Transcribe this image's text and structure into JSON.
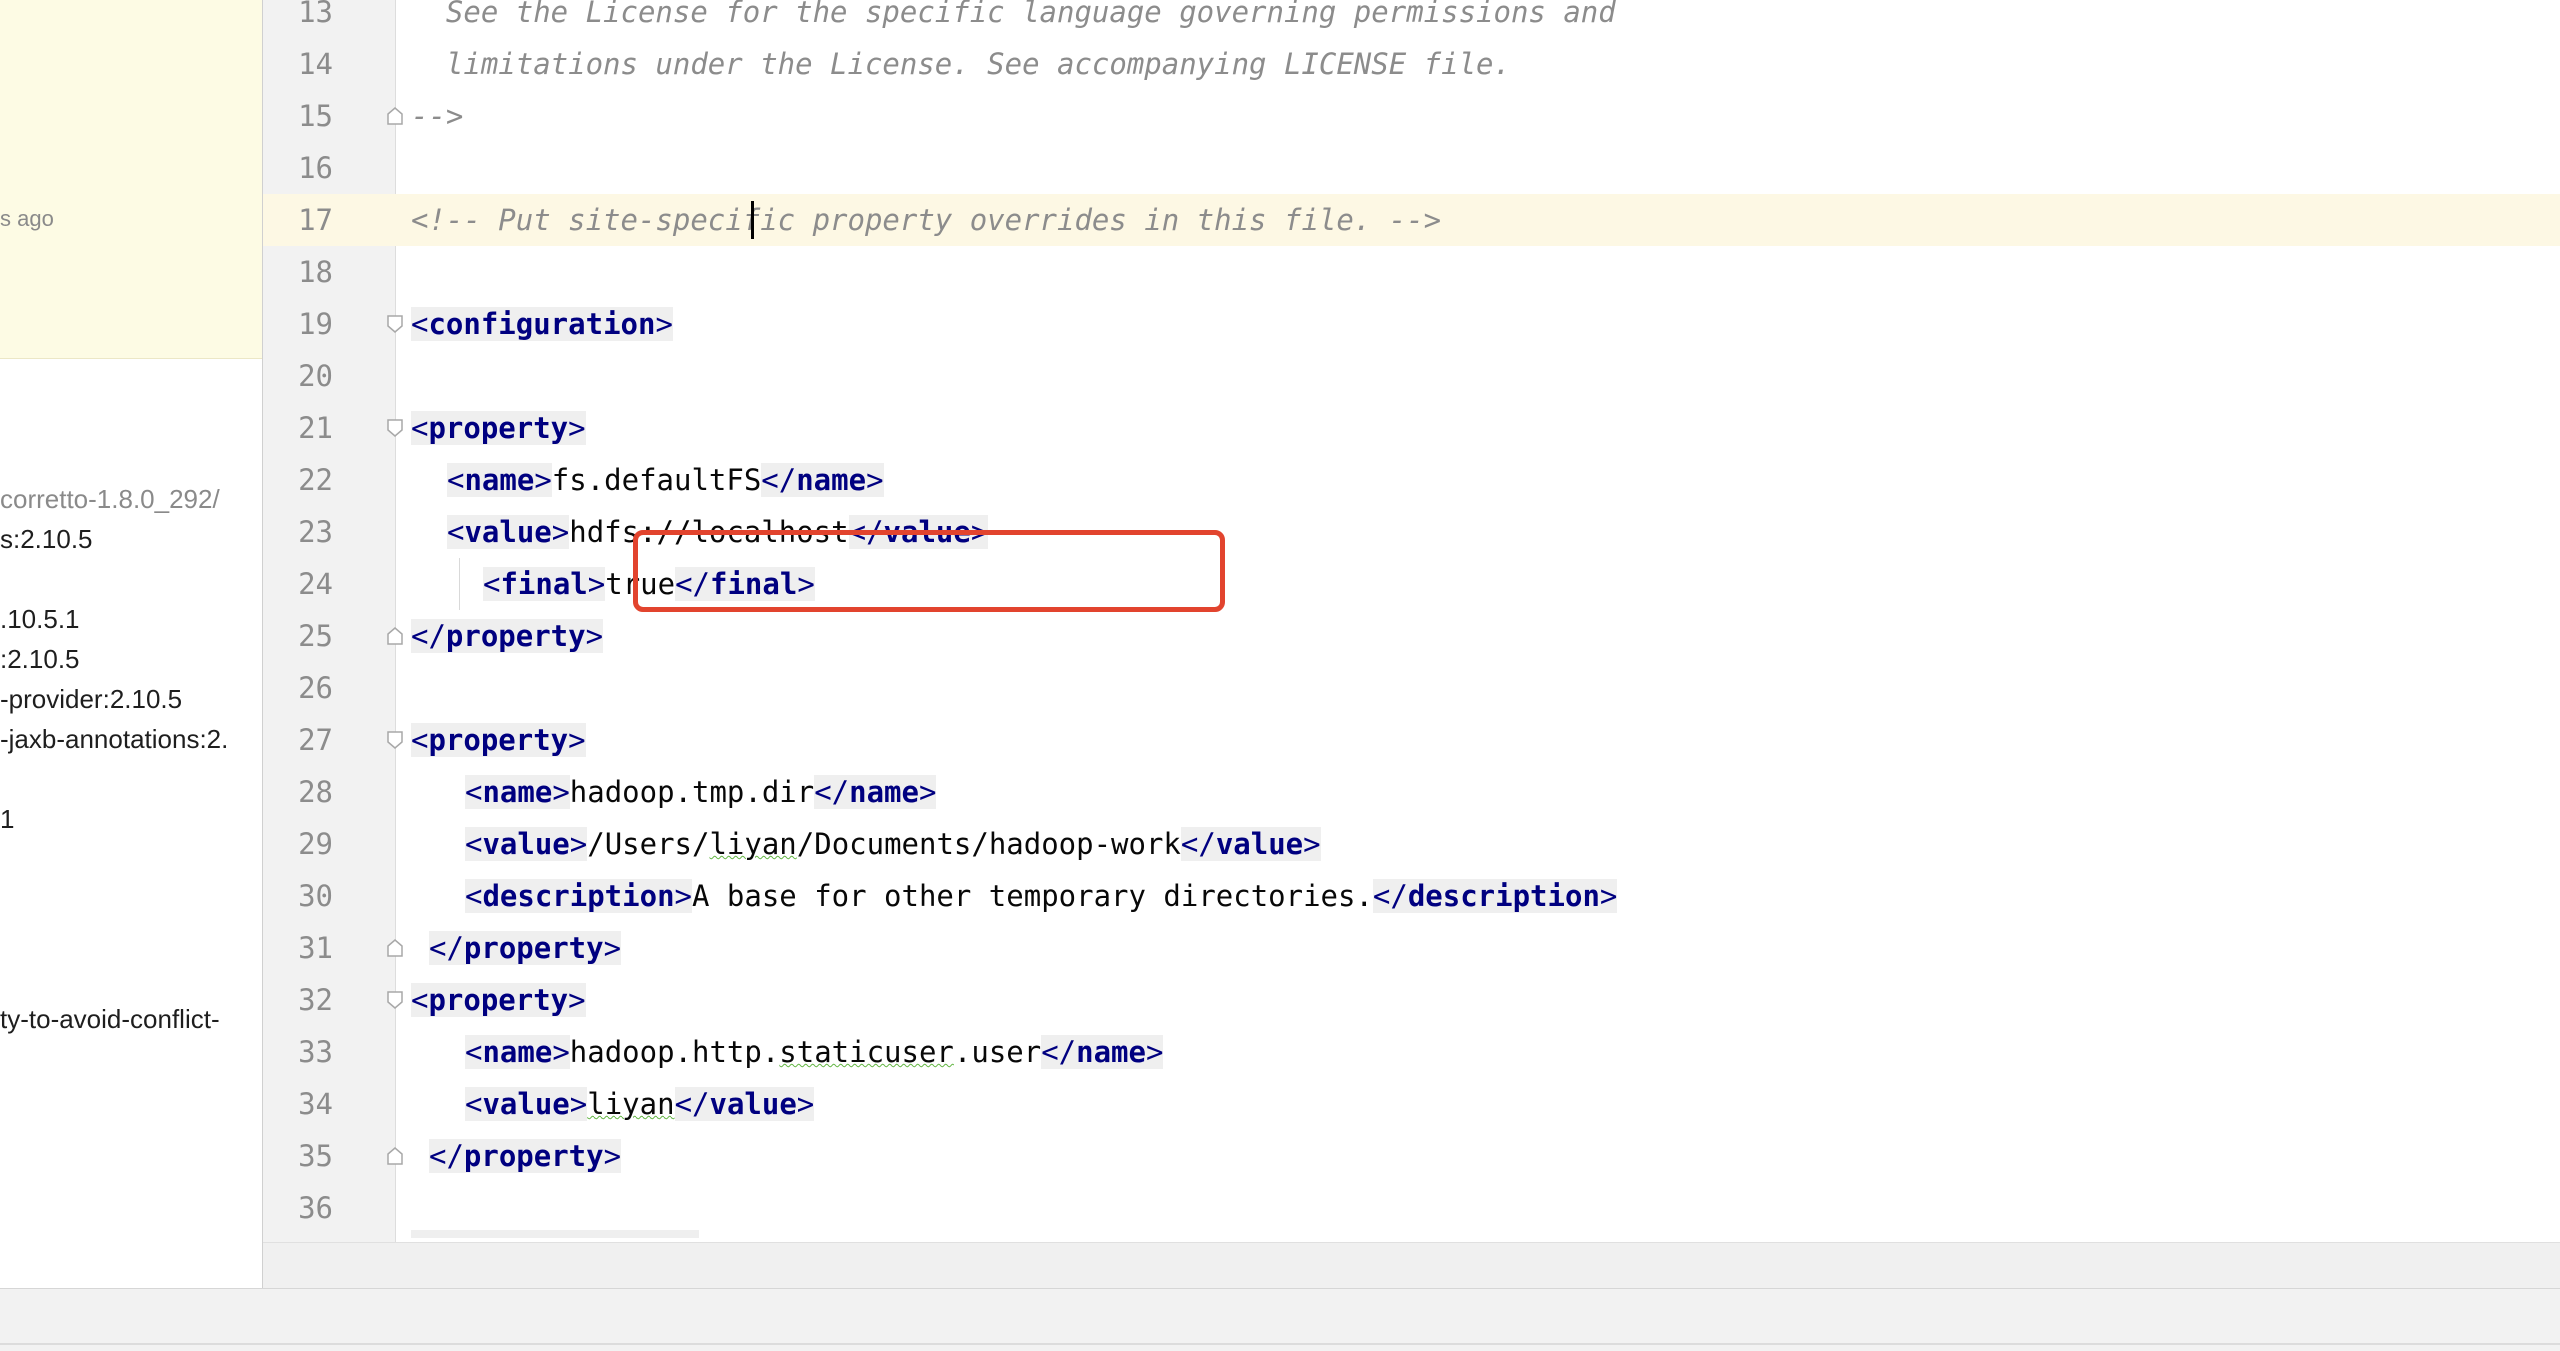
{
  "left_panel": {
    "vcs_time": "s ago",
    "libraries": [
      {
        "text": " corretto-1.8.0_292/",
        "muted": true
      },
      {
        "text": "s:2.10.5",
        "muted": false
      },
      {
        "text": "",
        "muted": false
      },
      {
        "text": ".10.5.1",
        "muted": false
      },
      {
        "text": ":2.10.5",
        "muted": false
      },
      {
        "text": "-provider:2.10.5",
        "muted": false
      },
      {
        "text": "-jaxb-annotations:2.",
        "muted": false
      },
      {
        "text": "",
        "muted": false
      },
      {
        "text": "1",
        "muted": false
      },
      {
        "text": "ty-to-avoid-conflict-",
        "muted": false
      }
    ]
  },
  "editor": {
    "lines": [
      {
        "n": "13",
        "text": "  See the License for the specific language governing permissions and"
      },
      {
        "n": "14",
        "text": "  limitations under the License. See accompanying LICENSE file."
      },
      {
        "n": "15",
        "text": "-->"
      },
      {
        "n": "16",
        "text": ""
      },
      {
        "n": "17",
        "text": "<!-- Put site-specific property overrides in this file. -->"
      },
      {
        "n": "18",
        "text": ""
      },
      {
        "n": "19",
        "tag": "configuration"
      },
      {
        "n": "20",
        "text": ""
      },
      {
        "n": "21",
        "tag": "property"
      },
      {
        "n": "22",
        "name_tag": "name",
        "value": "fs.defaultFS"
      },
      {
        "n": "23",
        "name_tag": "value",
        "value": "hdfs://localhost"
      },
      {
        "n": "24",
        "name_tag": "final",
        "value": "true"
      },
      {
        "n": "25",
        "close_tag": "property"
      },
      {
        "n": "26",
        "text": ""
      },
      {
        "n": "27",
        "tag": "property"
      },
      {
        "n": "28",
        "name_tag": "name",
        "value": "hadoop.tmp.dir"
      },
      {
        "n": "29",
        "name_tag": "value",
        "value": "/Users/liyan/Documents/hadoop-work"
      },
      {
        "n": "30",
        "name_tag": "description",
        "value": "A base for other temporary directories."
      },
      {
        "n": "31",
        "close_tag": "property"
      },
      {
        "n": "32",
        "tag": "property"
      },
      {
        "n": "33",
        "name_tag": "name",
        "value": "hadoop.http.staticuser.user"
      },
      {
        "n": "34",
        "name_tag": "value",
        "value": "liyan"
      },
      {
        "n": "35",
        "close_tag": "property"
      },
      {
        "n": "36",
        "text": ""
      }
    ],
    "tags": {
      "configuration": "configuration",
      "property": "property",
      "name": "name",
      "value": "value",
      "final": "final",
      "description": "description"
    },
    "values": {
      "fs_default": "fs.defaultFS",
      "hdfs": "hdfs://localhost",
      "final_true": "true",
      "tmp_dir": "hadoop.tmp.dir",
      "tmp_path_a": "/Users/",
      "tmp_path_user": "liyan",
      "tmp_path_b": "/Documents/hadoop-work",
      "description": "A base for other temporary directories.",
      "staticuser_a": "hadoop.http.",
      "staticuser_b": "staticuser",
      "staticuser_c": ".user",
      "liyan": "liyan"
    },
    "comments": {
      "line13": "  See the License for the specific language governing permissions and",
      "line14": "  limitations under the License. See accompanying LICENSE file.",
      "line15": "-->",
      "line17_a": "<!-- Put site-speci",
      "line17_b": "fic property overrides in this file. -->"
    },
    "colors": {
      "tag": "#000080",
      "comment": "#8c8c8c",
      "highlight_box": "#e2442e",
      "current_line": "#fdf8e4",
      "vcs_popup": "#fdfbe4"
    }
  }
}
